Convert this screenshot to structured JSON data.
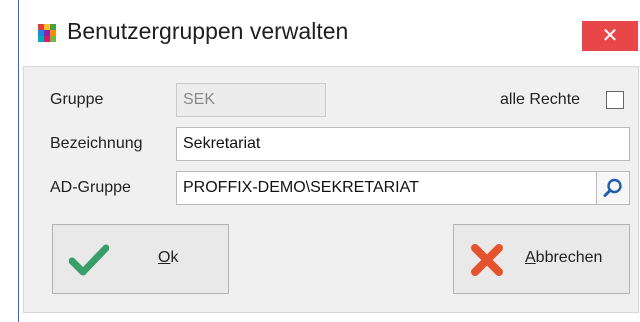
{
  "window": {
    "title": "Benutzergruppen verwalten",
    "close_glyph": "✕"
  },
  "form": {
    "group_label": "Gruppe",
    "group_value": "SEK",
    "all_rights_label": "alle Rechte",
    "all_rights_checked": false,
    "description_label": "Bezeichnung",
    "description_value": "Sekretariat",
    "ad_group_label": "AD-Gruppe",
    "ad_group_value": "PROFFIX-DEMO\\SEKRETARIAT"
  },
  "buttons": {
    "ok_mnemonic": "O",
    "ok_rest": "k",
    "cancel_mnemonic": "A",
    "cancel_rest": "bbrechen"
  },
  "colors": {
    "close_bg": "#e8474a",
    "ok_check": "#3a9e6a",
    "cancel_x": "#e4532c",
    "search_icon": "#1e5fa8"
  },
  "icons": {
    "app": "app-grid-icon",
    "close": "close-icon",
    "search": "search-icon",
    "ok": "checkmark-icon",
    "cancel": "cross-icon"
  }
}
